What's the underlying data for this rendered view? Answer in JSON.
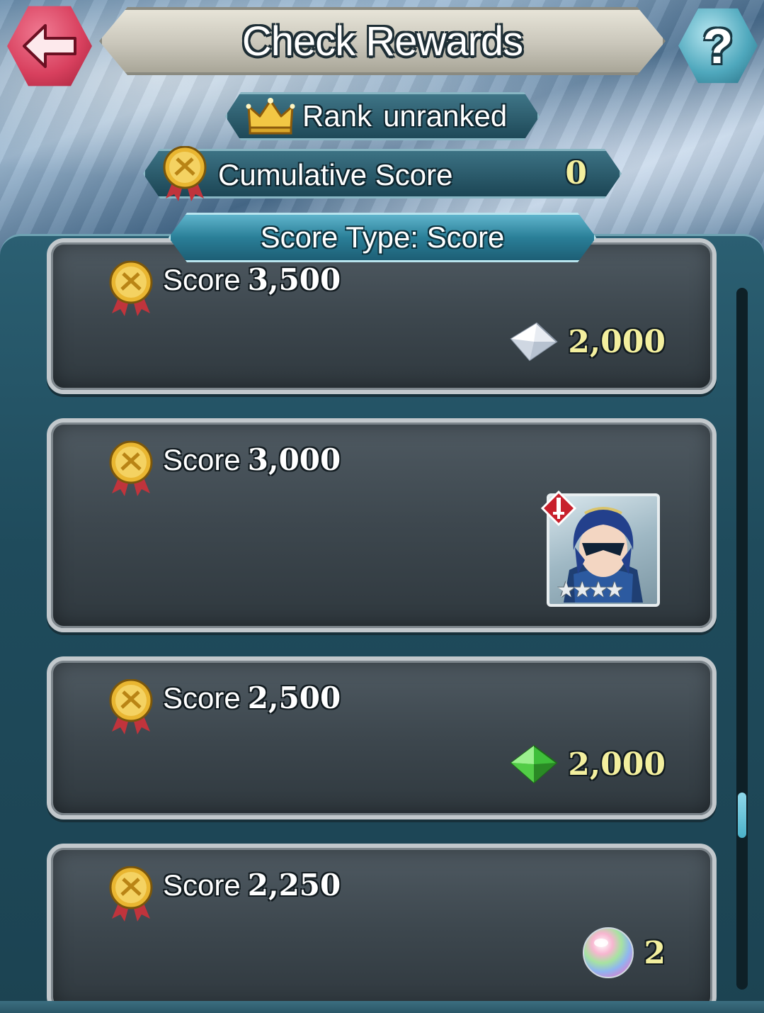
{
  "header": {
    "title": "Check Rewards",
    "back_icon": "back-arrow-icon",
    "help_label": "?"
  },
  "rank": {
    "label": "Rank",
    "value": "unranked",
    "icon": "crown-icon"
  },
  "cumulative": {
    "label": "Cumulative Score",
    "value": "0",
    "icon": "medal-icon"
  },
  "score_type": {
    "label": "Score Type: Score"
  },
  "rewards": [
    {
      "label": "Score",
      "threshold": "3,500",
      "reward_icon": "light-crystal-icon",
      "amount": "2,000"
    },
    {
      "label": "Score",
      "threshold": "3,000",
      "reward_icon": "hero-portrait-icon",
      "stars": "★★★★"
    },
    {
      "label": "Score",
      "threshold": "2,500",
      "reward_icon": "green-crystal-icon",
      "amount": "2,000"
    },
    {
      "label": "Score",
      "threshold": "2,250",
      "reward_icon": "orb-icon",
      "amount": "2"
    }
  ],
  "colors": {
    "accent_gold": "#f3ef9e",
    "back_button": "#d8405e",
    "help_button": "#4fa8bd"
  }
}
